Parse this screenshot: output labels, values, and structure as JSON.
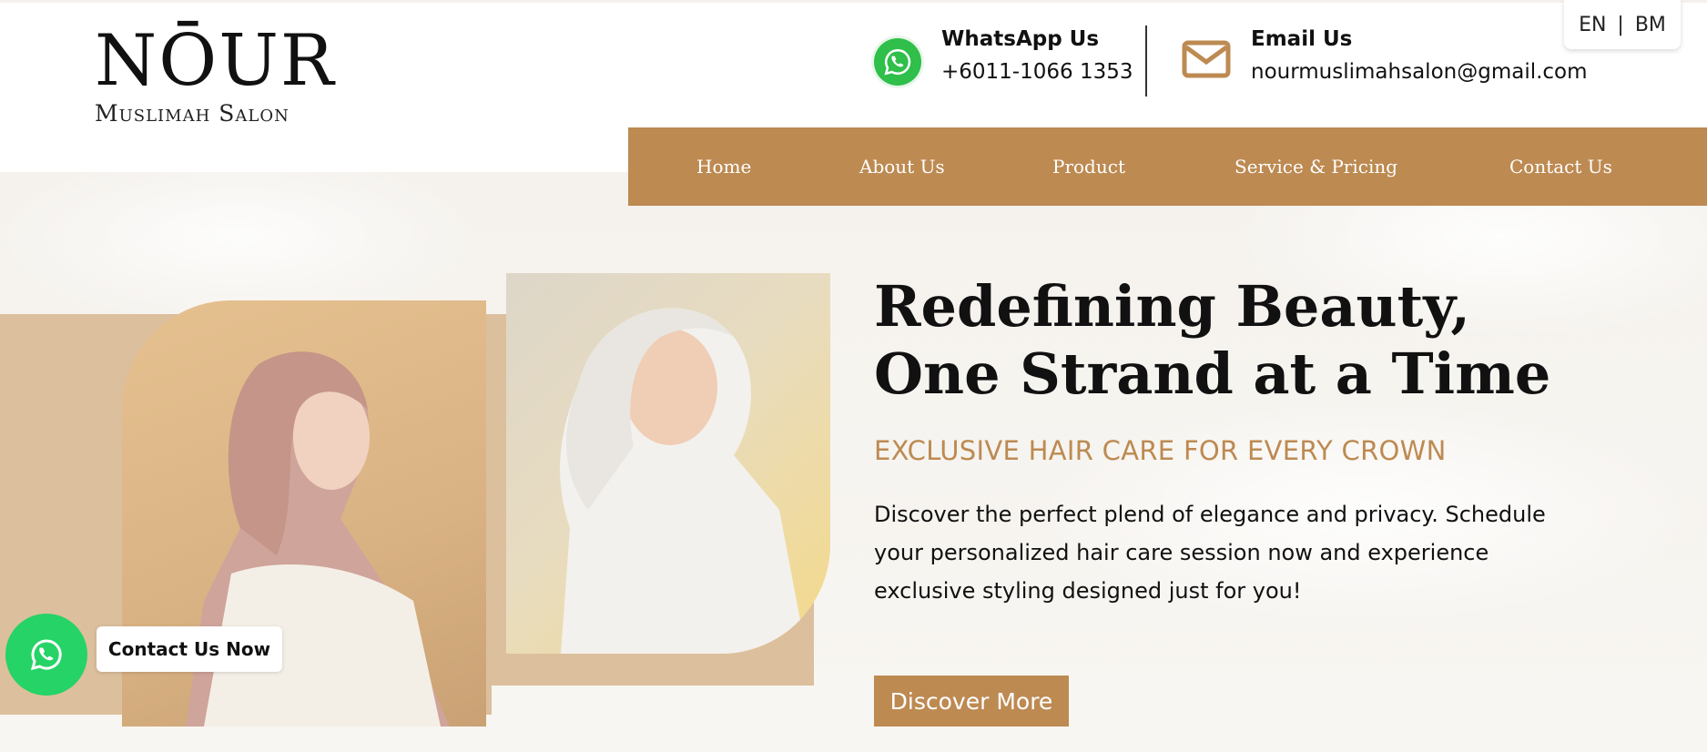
{
  "brand": {
    "name": "NŌUR",
    "tagline": "Muslimah Salon"
  },
  "language": {
    "options": [
      "EN",
      "BM"
    ],
    "separator": "|"
  },
  "contacts": {
    "whatsapp": {
      "label": "WhatsApp Us",
      "value": "+6011-1066 1353",
      "icon": "whatsapp-icon"
    },
    "email": {
      "label": "Email Us",
      "value": "nourmuslimahsalon@gmail.com",
      "icon": "mail-icon"
    }
  },
  "nav": {
    "items": [
      "Home",
      "About Us",
      "Product",
      "Service & Pricing",
      "Contact Us"
    ]
  },
  "hero": {
    "title_line1": "Redefining Beauty,",
    "title_line2": "One Strand at a Time",
    "subtitle": "EXCLUSIVE HAIR CARE FOR EVERY CROWN",
    "body": "Discover the perfect plend of elegance and privacy. Schedule your personalized hair care session now and experience exclusive styling designed just for you!",
    "cta": "Discover More"
  },
  "floating": {
    "label": "Contact Us Now",
    "icon": "whatsapp-icon"
  },
  "colors": {
    "accent": "#bd8a52",
    "whatsapp": "#25d366",
    "text": "#111111"
  }
}
